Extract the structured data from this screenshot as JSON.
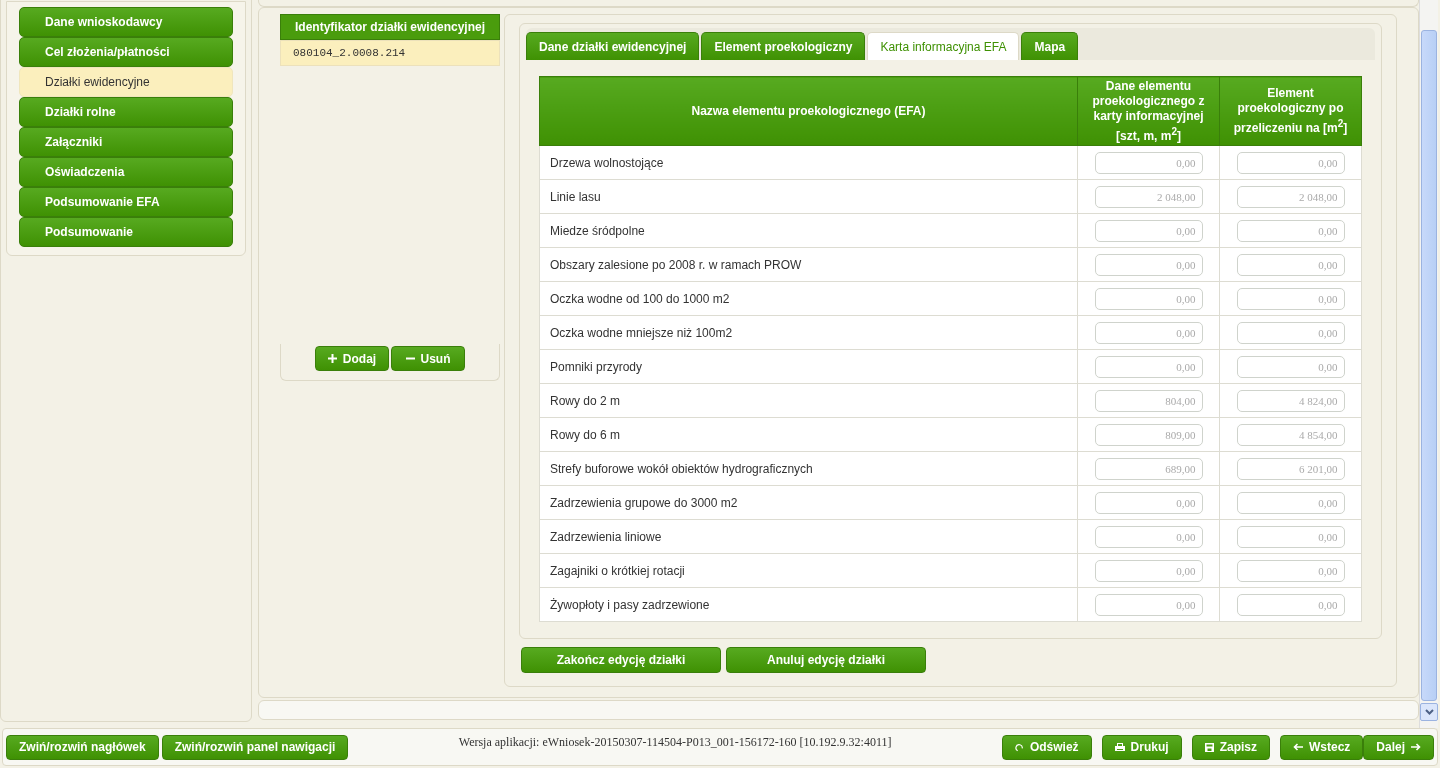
{
  "nav": [
    {
      "label": "Dane wnioskodawcy",
      "selected": false
    },
    {
      "label": "Cel złożenia/płatności",
      "selected": false
    },
    {
      "label": "Działki ewidencyjne",
      "selected": true
    },
    {
      "label": "Działki rolne",
      "selected": false
    },
    {
      "label": "Załączniki",
      "selected": false
    },
    {
      "label": "Oświadczenia",
      "selected": false
    },
    {
      "label": "Podsumowanie EFA",
      "selected": false
    },
    {
      "label": "Podsumowanie",
      "selected": false
    }
  ],
  "parcels": {
    "header": "Identyfikator działki ewidencyjnej",
    "rows": [
      {
        "id": "080104_2.0008.214",
        "selected": true
      }
    ],
    "buttons": [
      {
        "label": "Dodaj",
        "kind": "add"
      },
      {
        "label": "Usuń",
        "kind": "remove"
      }
    ]
  },
  "tabs": [
    {
      "label": "Dane działki ewidencyjnej",
      "selected": false
    },
    {
      "label": "Element proekologiczny",
      "selected": false
    },
    {
      "label": "Karta informacyjna EFA",
      "selected": true
    },
    {
      "label": "Mapa",
      "selected": false
    }
  ],
  "table": {
    "columns": [
      "Nazwa elementu proekologicznego (EFA)",
      "Dane elementu proekologicznego z karty informacyjnej [szt, m, m$^{2}$]",
      "Element proekologiczny po przeliczeniu na [m$^{2}$]"
    ],
    "rows": [
      {
        "name": "Drzewa wolnostojące",
        "data": "0,00",
        "converted": "0,00"
      },
      {
        "name": "Linie lasu",
        "data": "2 048,00",
        "converted": "2 048,00"
      },
      {
        "name": "Miedze śródpolne",
        "data": "0,00",
        "converted": "0,00"
      },
      {
        "name": "Obszary zalesione po 2008 r. w ramach PROW",
        "data": "0,00",
        "converted": "0,00"
      },
      {
        "name": "Oczka wodne od 100 do 1000 m2",
        "data": "0,00",
        "converted": "0,00"
      },
      {
        "name": "Oczka wodne mniejsze niż 100m2",
        "data": "0,00",
        "converted": "0,00"
      },
      {
        "name": "Pomniki przyrody",
        "data": "0,00",
        "converted": "0,00"
      },
      {
        "name": "Rowy do 2 m",
        "data": "804,00",
        "converted": "4 824,00"
      },
      {
        "name": "Rowy do 6 m",
        "data": "809,00",
        "converted": "4 854,00"
      },
      {
        "name": "Strefy buforowe wokół obiektów hydrograficznych",
        "data": "689,00",
        "converted": "6 201,00"
      },
      {
        "name": "Zadrzewienia grupowe do 3000 m2",
        "data": "0,00",
        "converted": "0,00"
      },
      {
        "name": "Zadrzewienia liniowe",
        "data": "0,00",
        "converted": "0,00"
      },
      {
        "name": "Zagajniki o krótkiej rotacji",
        "data": "0,00",
        "converted": "0,00"
      },
      {
        "name": "Żywopłoty i pasy zadrzewione",
        "data": "0,00",
        "converted": "0,00"
      }
    ]
  },
  "edit_buttons": [
    "Zakończ edycję działki",
    "Anuluj edycję działki"
  ],
  "footer": {
    "left_buttons": [
      "Zwiń/rozwiń nagłówek",
      "Zwiń/rozwiń panel nawigacji"
    ],
    "version": "Wersja aplikacji: eWniosek-20150307-114504-P013_001-156172-160 [10.192.9.32:4011]",
    "right_buttons": [
      {
        "label": "Odśwież",
        "kind": "refresh"
      },
      {
        "label": "Drukuj",
        "kind": "print"
      },
      {
        "label": "Zapisz",
        "kind": "save"
      },
      {
        "label": "Wstecz",
        "kind": "back"
      },
      {
        "label": "Dalej",
        "kind": "next"
      }
    ]
  }
}
